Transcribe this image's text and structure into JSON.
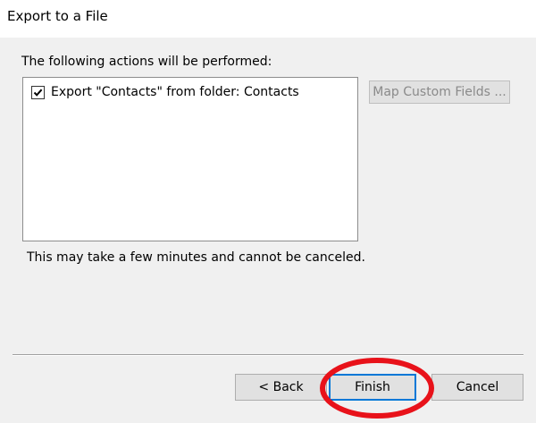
{
  "window": {
    "title": "Export to a File"
  },
  "main": {
    "header_label": "The following actions will be performed:",
    "actions": [
      {
        "label": "Export \"Contacts\" from folder: Contacts",
        "checked": true
      }
    ],
    "map_button_label": "Map Custom Fields ...",
    "note": "This may take a few minutes and cannot be canceled."
  },
  "footer": {
    "back_label": "< Back",
    "finish_label": "Finish",
    "cancel_label": "Cancel"
  },
  "colors": {
    "highlight_circle": "#e8121a",
    "default_button_border": "#0078d7"
  }
}
